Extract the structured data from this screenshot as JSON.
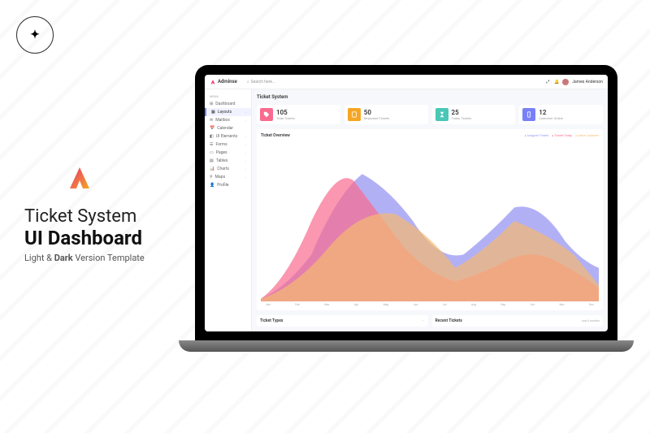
{
  "promo": {
    "title1": "Ticket System",
    "title2": "UI Dashboard",
    "subtitle": "Light & Dark Version Template"
  },
  "brand": "Adminse",
  "search_placeholder": "Search here...",
  "username": "James Anderson",
  "sidebar": {
    "heading": "MENU",
    "items": [
      {
        "label": "Dashboard"
      },
      {
        "label": "Layouts"
      },
      {
        "label": "Mailbox"
      },
      {
        "label": "Calendar"
      },
      {
        "label": "UI Elements"
      },
      {
        "label": "Forms"
      },
      {
        "label": "Pages"
      },
      {
        "label": "Tables"
      },
      {
        "label": "Charts"
      },
      {
        "label": "Maps"
      },
      {
        "label": "Profile"
      }
    ]
  },
  "page_title": "Ticket System",
  "stats": [
    {
      "value": "105",
      "label": "Total Tickets",
      "color": "#f96b8f"
    },
    {
      "value": "50",
      "label": "Responed Tickets",
      "color": "#f5a623"
    },
    {
      "value": "25",
      "label": "Today Tickets",
      "color": "#4ac7b7"
    },
    {
      "value": "12",
      "label": "Customer Online",
      "color": "#7980f7"
    }
  ],
  "chart": {
    "title": "Ticket Overview",
    "legend": [
      "Assigned Tickets",
      "Tickets Today",
      "Online Customer"
    ],
    "xaxis": [
      "Jan",
      "Feb",
      "Mar",
      "Apr",
      "May",
      "Jun",
      "Jul",
      "Aug",
      "Sep",
      "Oct",
      "Nov",
      "Dec"
    ]
  },
  "bottom": {
    "card1": "Ticket Types",
    "card2": "Recent Tickets",
    "card2_sub": "Last 6 months"
  },
  "chart_data": {
    "type": "area",
    "x": [
      "Jan",
      "Feb",
      "Mar",
      "Apr",
      "May",
      "Jun",
      "Jul",
      "Aug",
      "Sep",
      "Oct",
      "Nov",
      "Dec"
    ],
    "series": [
      {
        "name": "Assigned Tickets",
        "color": "#9896f1",
        "values": [
          5,
          20,
          60,
          85,
          70,
          40,
          25,
          30,
          55,
          65,
          45,
          30
        ]
      },
      {
        "name": "Tickets Today",
        "color": "#f96b8f",
        "values": [
          5,
          25,
          70,
          55,
          35,
          20,
          10,
          12,
          20,
          28,
          22,
          12
        ]
      },
      {
        "name": "Online Customer",
        "color": "#f5b971",
        "values": [
          5,
          12,
          35,
          50,
          58,
          48,
          30,
          22,
          35,
          50,
          38,
          20
        ]
      }
    ],
    "ylim": [
      0,
      100
    ],
    "title": "Ticket Overview"
  }
}
